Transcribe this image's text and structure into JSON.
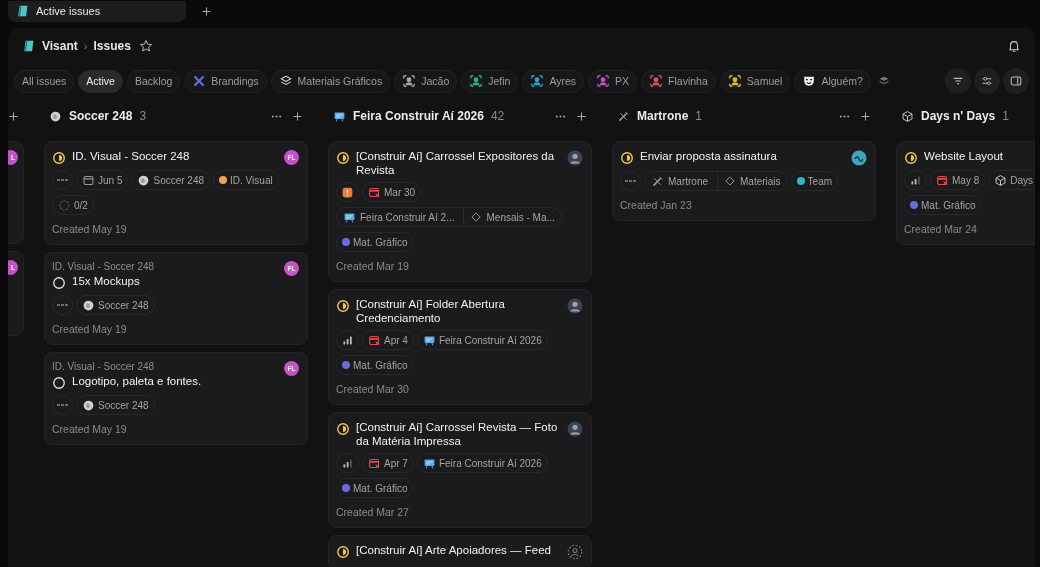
{
  "tabs": [
    {
      "label": "Active issues",
      "selected": true
    }
  ],
  "breadcrumb": {
    "workspace": "Visant",
    "separator": "›",
    "page": "Issues"
  },
  "views": [
    {
      "label": "All issues",
      "selected": false,
      "kind": "text"
    },
    {
      "label": "Active",
      "selected": true,
      "kind": "text"
    },
    {
      "label": "Backlog",
      "selected": false,
      "kind": "text"
    },
    {
      "label": "Brandings",
      "selected": false,
      "kind": "crossed-tools"
    },
    {
      "label": "Materiais Gráficos",
      "selected": false,
      "kind": "layers"
    },
    {
      "label": "Jacão",
      "selected": false,
      "kind": "person",
      "color": "#a8a8a8"
    },
    {
      "label": "Jefin",
      "selected": false,
      "kind": "person",
      "color": "#2fb57a"
    },
    {
      "label": "Ayres",
      "selected": false,
      "kind": "person",
      "color": "#2aa8c8"
    },
    {
      "label": "PX",
      "selected": false,
      "kind": "person",
      "color": "#c84fc8"
    },
    {
      "label": "Flavinha",
      "selected": false,
      "kind": "person",
      "color": "#e05555"
    },
    {
      "label": "Samuel",
      "selected": false,
      "kind": "person",
      "color": "#e0c020"
    },
    {
      "label": "Alguém?",
      "selected": false,
      "kind": "mask"
    }
  ],
  "board": {
    "clipped_column": {
      "cards": [
        {
          "assignee": {
            "kind": "initials-cut",
            "initials": "L",
            "color": "#c452c8"
          }
        },
        {
          "assignee": {
            "kind": "initials-cut",
            "initials": "L",
            "color": "#c452c8"
          }
        }
      ]
    },
    "columns": [
      {
        "name": "Soccer 248",
        "count": "3",
        "kind": "ball",
        "cards": [
          {
            "title": "ID. Visual - Soccer 248",
            "kind": "in-progress",
            "assignee": {
              "kind": "initials",
              "initials": "FL",
              "color": "#c452c8"
            },
            "chip_rows": [
              [
                {
                  "kind": "no-priority"
                },
                {
                  "kind": "date",
                  "label": "Jun 5",
                  "overdue": false
                },
                {
                  "kind": "project-ball",
                  "label": "Soccer 248"
                },
                {
                  "kind": "label",
                  "label": "ID. Visual",
                  "color": "#f0a34a"
                }
              ],
              [
                {
                  "kind": "subissues",
                  "label": "0/2"
                }
              ]
            ],
            "created": "Created May 19"
          },
          {
            "parent": "ID. Visual - Soccer 248",
            "title": "15x Mockups",
            "kind": "todo",
            "assignee": {
              "kind": "initials",
              "initials": "FL",
              "color": "#c452c8"
            },
            "chip_rows": [
              [
                {
                  "kind": "no-priority"
                },
                {
                  "kind": "project-ball",
                  "label": "Soccer 248"
                }
              ]
            ],
            "created": "Created May 19"
          },
          {
            "parent": "ID. Visual - Soccer 248",
            "title": "Logotipo, paleta e fontes.",
            "kind": "todo",
            "assignee": {
              "kind": "initials",
              "initials": "FL",
              "color": "#c452c8"
            },
            "chip_rows": [
              [
                {
                  "kind": "no-priority"
                },
                {
                  "kind": "project-ball",
                  "label": "Soccer 248"
                }
              ]
            ],
            "created": "Created May 19"
          }
        ]
      },
      {
        "name": "Feira Construir Aí 2026",
        "count": "42",
        "kind": "board",
        "cards": [
          {
            "title": "[Construir Aí] Carrossel Expositores da Revista",
            "kind": "in-progress",
            "assignee": {
              "kind": "photo"
            },
            "chip_rows": [
              [
                {
                  "kind": "urgent-priority"
                },
                {
                  "kind": "date",
                  "label": "Mar 30",
                  "overdue": true
                }
              ],
              [
                {
                  "kind": "project-board",
                  "label": "Feira Construir Aí 2...",
                  "milestone": "Mensais - Ma..."
                }
              ],
              [
                {
                  "kind": "label",
                  "label": "Mat. Gráfico",
                  "color": "#6b6bde"
                }
              ]
            ],
            "created": "Created Mar 19"
          },
          {
            "title": "[Construir Aí] Folder Abertura Credenciamento",
            "kind": "in-progress",
            "assignee": {
              "kind": "photo"
            },
            "chip_rows": [
              [
                {
                  "kind": "high-priority"
                },
                {
                  "kind": "date",
                  "label": "Apr 4",
                  "overdue": true
                },
                {
                  "kind": "project-board",
                  "label": "Feira Construir Aí 2026"
                }
              ],
              [
                {
                  "kind": "label",
                  "label": "Mat. Gráfico",
                  "color": "#6b6bde"
                }
              ]
            ],
            "created": "Created Mar 30"
          },
          {
            "title": "[Construir Aí] Carrossel Revista — Foto da Matéria Impressa",
            "kind": "in-progress",
            "assignee": {
              "kind": "photo"
            },
            "chip_rows": [
              [
                {
                  "kind": "medium-priority"
                },
                {
                  "kind": "date",
                  "label": "Apr 7",
                  "overdue": true
                },
                {
                  "kind": "project-board",
                  "label": "Feira Construir Aí 2026"
                }
              ],
              [
                {
                  "kind": "label",
                  "label": "Mat. Gráfico",
                  "color": "#6b6bde"
                }
              ]
            ],
            "created": "Created Mar 27"
          },
          {
            "title": "[Construir Aí] Arte Apoiadores — Feed",
            "kind": "in-progress",
            "assignee": {
              "kind": "unassigned"
            }
          }
        ]
      },
      {
        "name": "Martrone",
        "count": "1",
        "kind": "pen",
        "cards": [
          {
            "title": "Enviar proposta assinatura",
            "kind": "in-progress",
            "assignee": {
              "kind": "logo",
              "color": "#3aa6c0"
            },
            "chip_rows": [
              [
                {
                  "kind": "no-priority"
                },
                {
                  "kind": "project-pen",
                  "label": "Martrone",
                  "milestone": "Materiais"
                },
                {
                  "kind": "label",
                  "label": "Team",
                  "color": "#2bb5d0"
                }
              ]
            ],
            "created": "Created Jan 23"
          }
        ]
      },
      {
        "name": "Days n' Days",
        "count": "1",
        "kind": "cube",
        "cards": [
          {
            "title": "Website Layout",
            "kind": "in-progress",
            "chip_rows": [
              [
                {
                  "kind": "medium-priority"
                },
                {
                  "kind": "date",
                  "label": "May 8",
                  "overdue": true
                },
                {
                  "kind": "project-cube",
                  "label": "Days"
                }
              ],
              [
                {
                  "kind": "label",
                  "label": "Mat. Gráfico",
                  "color": "#6b6bde"
                }
              ]
            ],
            "created": "Created Mar 24"
          }
        ]
      }
    ]
  }
}
